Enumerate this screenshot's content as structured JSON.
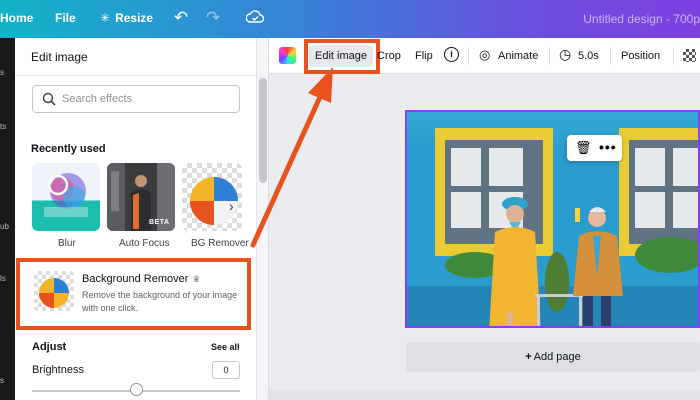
{
  "topbar": {
    "home": "Home",
    "file": "File",
    "resize": "Resize",
    "title": "Untitled design - 700p"
  },
  "rail": {
    "items": [
      "s",
      "ts",
      "ub",
      "ls",
      "s"
    ]
  },
  "panel": {
    "title": "Edit image",
    "search_placeholder": "Search effects",
    "recently_used": "Recently used",
    "effects": [
      {
        "label": "Blur"
      },
      {
        "label": "Auto Focus",
        "badge": "BETA"
      },
      {
        "label": "BG Remover"
      }
    ],
    "bg_remover": {
      "title": "Background Remover",
      "description": "Remove the background of your image with one click."
    },
    "adjust": "Adjust",
    "see_all": "See all",
    "brightness": {
      "label": "Brightness",
      "value": "0"
    }
  },
  "toolbar": {
    "edit_image": "Edit image",
    "crop": "Crop",
    "flip": "Flip",
    "info": "i",
    "animate": "Animate",
    "duration": "5.0s",
    "position": "Position"
  },
  "canvas": {
    "add_page": "Add page"
  },
  "colors": {
    "accent": "#8b3dff",
    "callout": "#e8521f",
    "topbar_start": "#12b4c8",
    "topbar_end": "#7d3fe0"
  }
}
